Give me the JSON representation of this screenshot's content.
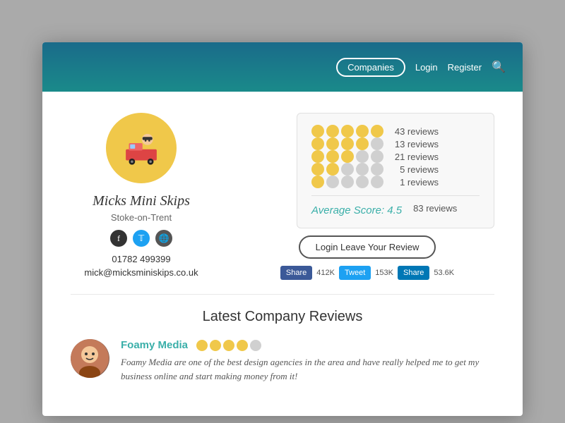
{
  "header": {
    "companies_label": "Companies",
    "login_label": "Login",
    "register_label": "Register"
  },
  "company": {
    "name": "Micks Mini Skips",
    "location": "Stoke-on-Trent",
    "phone": "01782 499399",
    "email": "mick@micksminiskips.co.uk"
  },
  "ratings": {
    "rows": [
      {
        "filled": 5,
        "empty": 0,
        "count": "43 reviews"
      },
      {
        "filled": 4,
        "empty": 1,
        "count": "13 reviews"
      },
      {
        "filled": 3,
        "empty": 2,
        "count": "21 reviews"
      },
      {
        "filled": 2,
        "empty": 3,
        "count": "5 reviews"
      },
      {
        "filled": 1,
        "empty": 4,
        "count": "1 reviews"
      }
    ],
    "average_label": "Average Score: 4.5",
    "total": "83 reviews"
  },
  "leave_review_btn": "Login Leave Your Review",
  "social": {
    "facebook_label": "Share",
    "facebook_count": "412K",
    "twitter_label": "Tweet",
    "twitter_count": "153K",
    "linkedin_label": "Share",
    "linkedin_count": "53.6K"
  },
  "latest_reviews": {
    "title": "Latest Company Reviews",
    "items": [
      {
        "name": "Foamy Media",
        "stars_filled": 4,
        "stars_empty": 1,
        "text": "Foamy Media are one of the best design agencies in the area and have really helped me to get my business online and start making money from it!"
      }
    ]
  }
}
